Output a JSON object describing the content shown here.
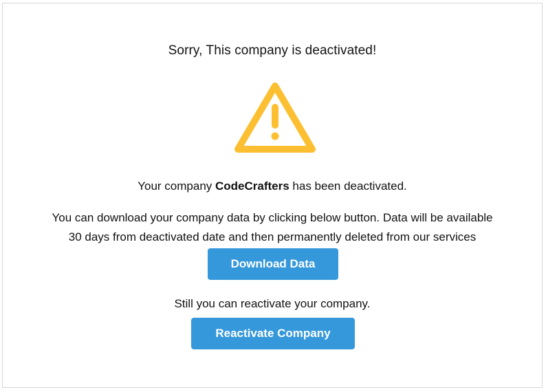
{
  "heading": "Sorry, This company is deactivated!",
  "icon": {
    "name": "warning-triangle-icon",
    "color": "#fbbf31"
  },
  "status": {
    "prefix": "Your company ",
    "company_name": "CodeCrafters",
    "suffix": " has been deactivated."
  },
  "info": {
    "line1": "You can download your company data by clicking below button. Data will be available",
    "line2": "30 days from deactivated date and then permanently deleted from our services"
  },
  "actions": {
    "download_label": "Download Data",
    "reactivate_prompt": "Still you can reactivate your company.",
    "reactivate_label": "Reactivate Company"
  },
  "colors": {
    "accent": "#3598db",
    "border": "#d6d6d6"
  }
}
